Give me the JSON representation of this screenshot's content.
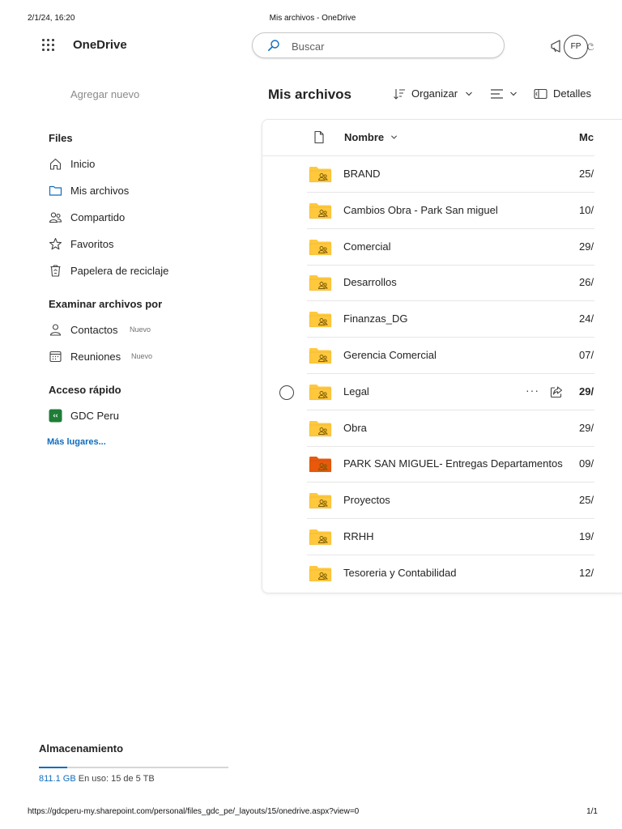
{
  "print": {
    "datetime": "2/1/24, 16:20",
    "title": "Mis archivos - OneDrive",
    "url": "https://gdcperu-my.sharepoint.com/personal/files_gdc_pe/_layouts/15/onedrive.aspx?view=0",
    "pages": "1/1"
  },
  "app": {
    "name": "OneDrive",
    "search_placeholder": "Buscar",
    "avatar_initials": "FP",
    "extra_glyph": "ල"
  },
  "sidebar": {
    "add_new": "Agregar nuevo",
    "files_section": "Files",
    "files_items": [
      {
        "label": "Inicio",
        "icon": "home-icon"
      },
      {
        "label": "Mis archivos",
        "icon": "folder-icon",
        "active": true
      },
      {
        "label": "Compartido",
        "icon": "people-icon"
      },
      {
        "label": "Favoritos",
        "icon": "star-icon"
      },
      {
        "label": "Papelera de reciclaje",
        "icon": "recycle-bin-icon"
      }
    ],
    "browse_section": "Examinar archivos por",
    "browse_items": [
      {
        "label": "Contactos",
        "badge": "Nuevo",
        "icon": "person-icon"
      },
      {
        "label": "Reuniones",
        "badge": "Nuevo",
        "icon": "calendar-icon"
      }
    ],
    "quick_section": "Acceso rápido",
    "quick_items": [
      {
        "label": "GDC Peru",
        "icon": "site-icon",
        "color": "#1e7d36"
      }
    ],
    "more_places": "Más lugares...",
    "storage": {
      "title": "Almacenamiento",
      "used": "811.1 GB",
      "text": "En uso: 15 de 5 TB",
      "fill_fraction": 0.15
    }
  },
  "main": {
    "title": "Mis archivos",
    "toolbar": {
      "sort_label": "Organizar",
      "details_label": "Detalles"
    },
    "columns": {
      "name": "Nombre",
      "modified": "Mc"
    },
    "rows": [
      {
        "name": "BRAND",
        "modified": "25/",
        "folder_color": "#ffc83d"
      },
      {
        "name": "Cambios Obra - Park San miguel",
        "modified": "10/",
        "folder_color": "#ffc83d"
      },
      {
        "name": "Comercial",
        "modified": "29/",
        "folder_color": "#ffc83d"
      },
      {
        "name": "Desarrollos",
        "modified": "26/",
        "folder_color": "#ffc83d"
      },
      {
        "name": "Finanzas_DG",
        "modified": "24/",
        "folder_color": "#ffc83d"
      },
      {
        "name": "Gerencia Comercial",
        "modified": "07/",
        "folder_color": "#ffc83d"
      },
      {
        "name": "Legal",
        "modified": "29/",
        "folder_color": "#ffc83d",
        "hover": true
      },
      {
        "name": "Obra",
        "modified": "29/",
        "folder_color": "#ffc83d"
      },
      {
        "name": "PARK SAN MIGUEL- Entregas Departamentos",
        "modified": "09/",
        "folder_color": "#e8590c"
      },
      {
        "name": "Proyectos",
        "modified": "25/",
        "folder_color": "#ffc83d"
      },
      {
        "name": "RRHH",
        "modified": "19/",
        "folder_color": "#ffc83d"
      },
      {
        "name": "Tesoreria y Contabilidad",
        "modified": "12/",
        "folder_color": "#ffc83d"
      }
    ],
    "more_glyph": "···"
  }
}
